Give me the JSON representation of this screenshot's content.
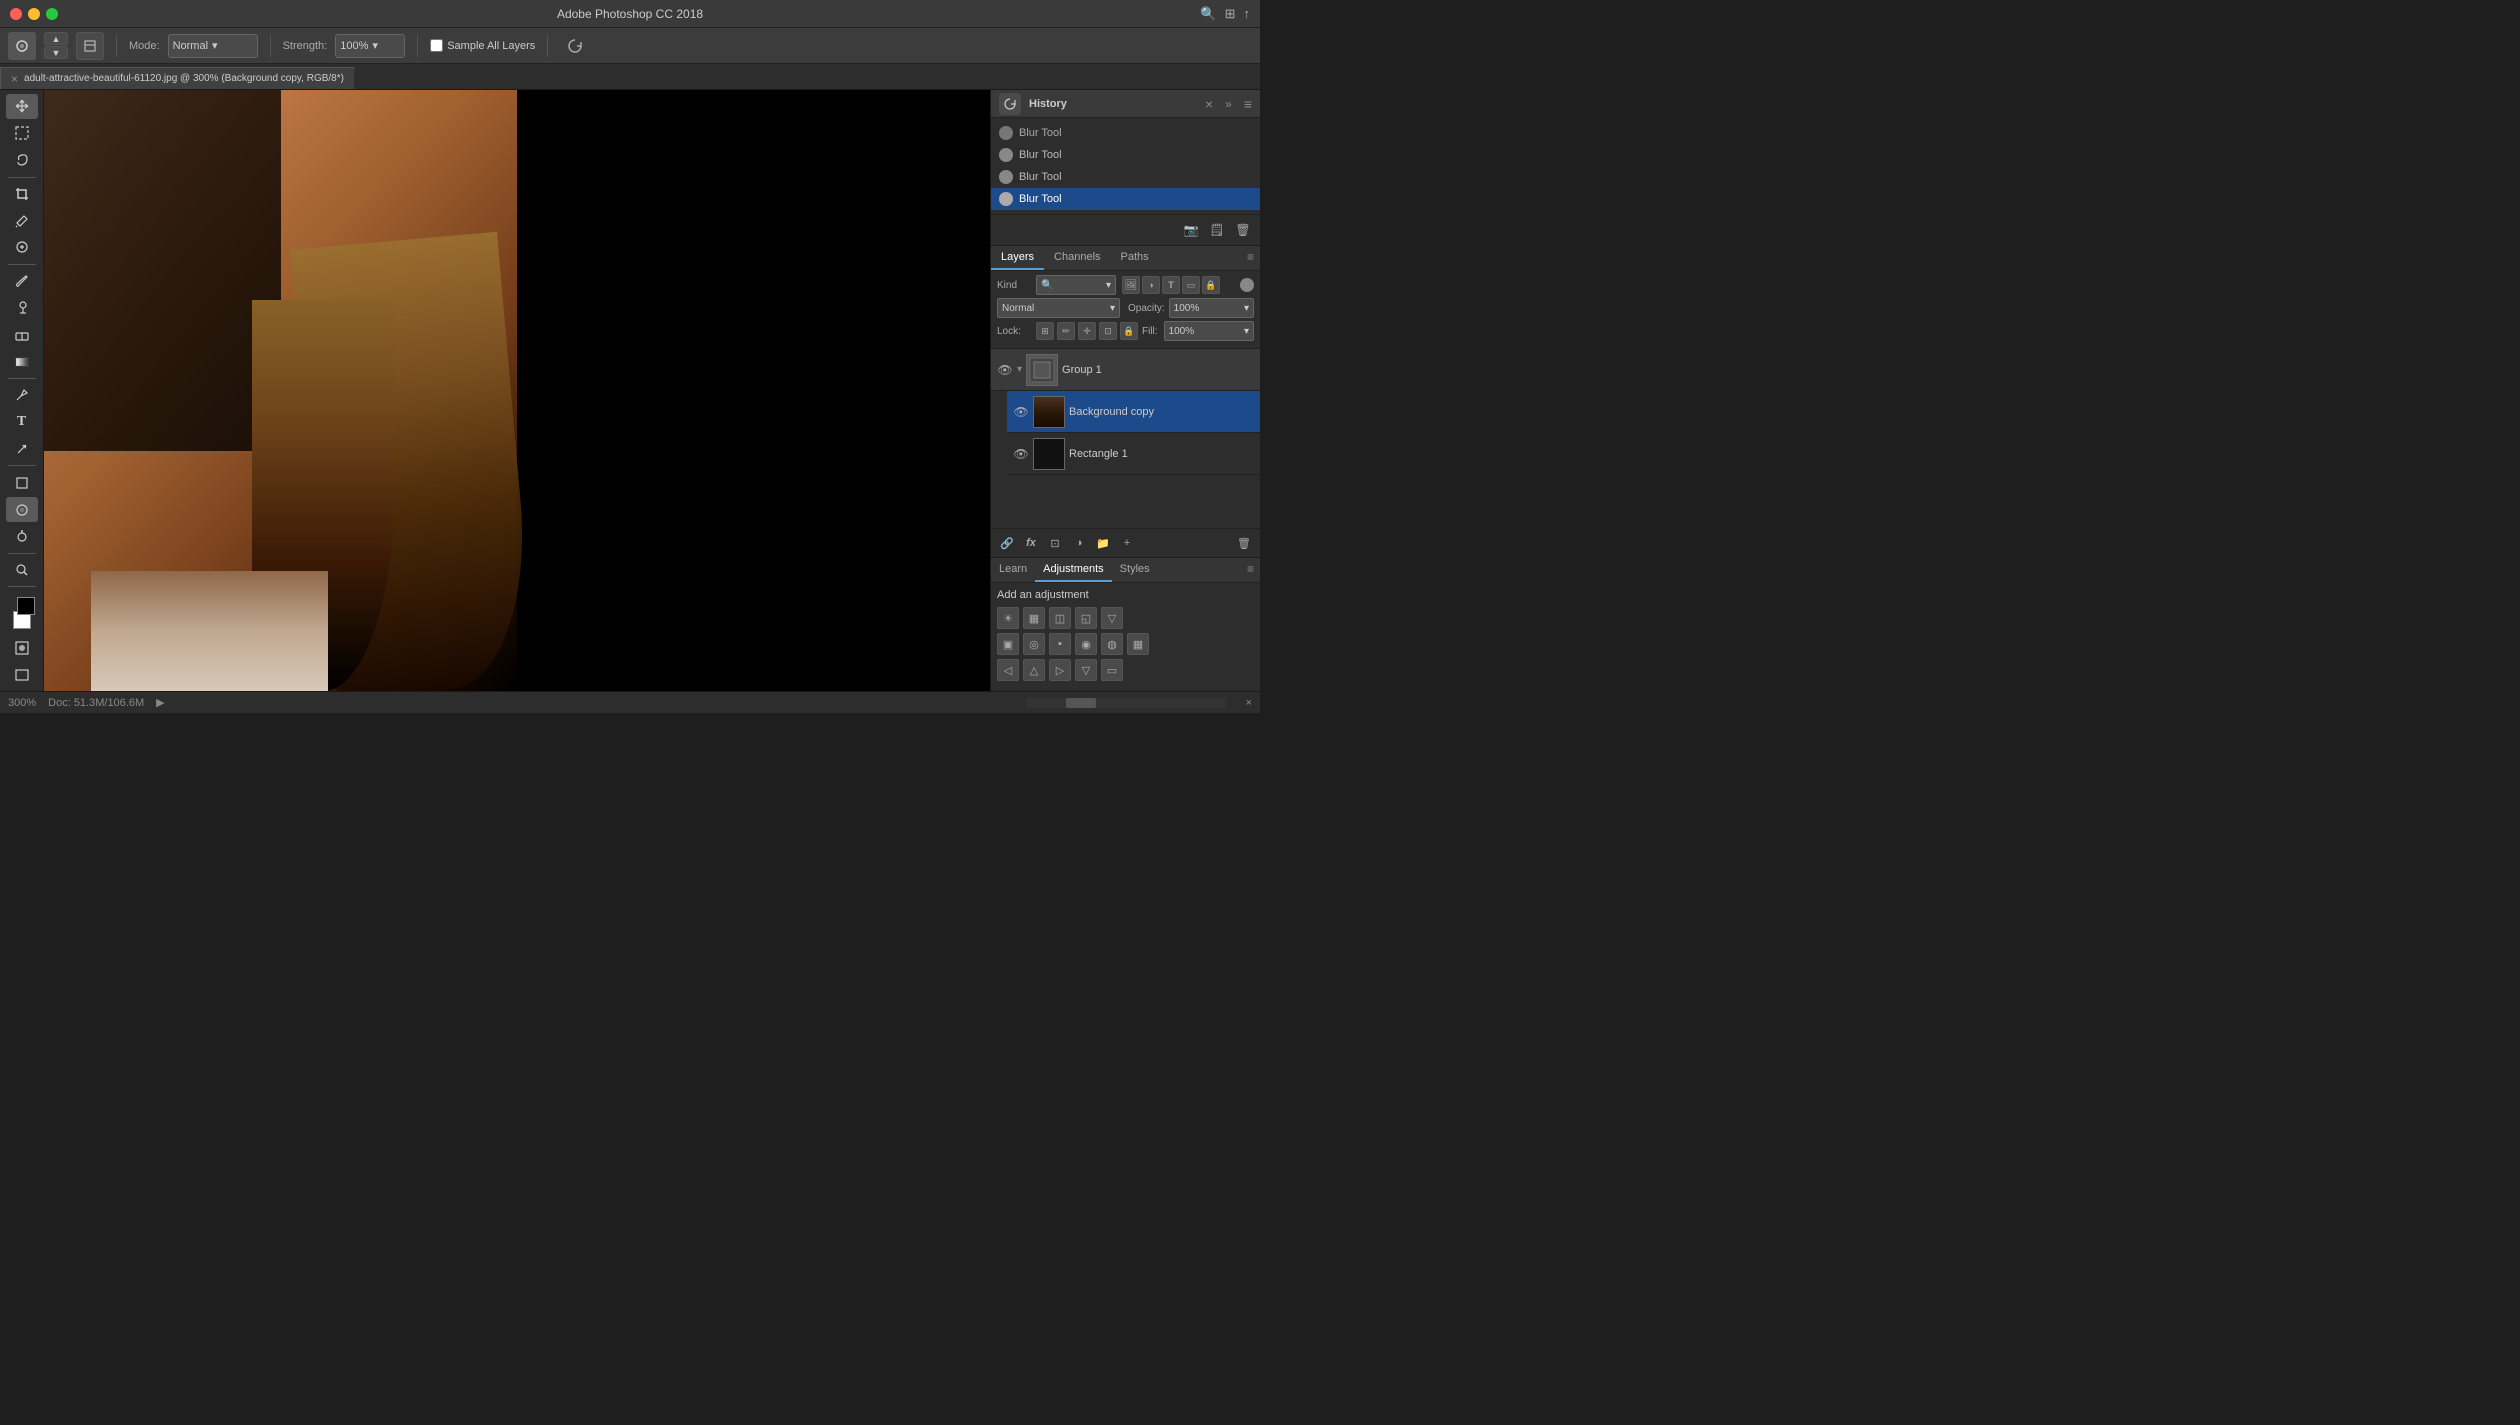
{
  "window": {
    "title": "Adobe Photoshop CC 2018",
    "traffic_lights": [
      "close",
      "minimize",
      "maximize"
    ]
  },
  "toolbar": {
    "mode_label": "Mode:",
    "mode_value": "Normal",
    "strength_label": "Strength:",
    "strength_value": "100%",
    "sample_all_layers_label": "Sample All Layers"
  },
  "doc_tab": {
    "name": "adult-attractive-beautiful-61120.jpg @ 300% (Background copy, RGB/8*)",
    "close": "×"
  },
  "history_panel": {
    "title": "History",
    "items": [
      {
        "label": "Blur Tool",
        "active": false
      },
      {
        "label": "Blur Tool",
        "active": false
      },
      {
        "label": "Blur Tool",
        "active": false
      },
      {
        "label": "Blur Tool",
        "active": true
      }
    ]
  },
  "layers_panel": {
    "tabs": [
      "Layers",
      "Channels",
      "Paths"
    ],
    "active_tab": "Layers",
    "blend_mode": "Normal",
    "opacity_label": "Opacity:",
    "opacity_value": "100%",
    "fill_label": "Fill:",
    "fill_value": "100%",
    "lock_label": "Lock:",
    "layers": [
      {
        "name": "Group 1",
        "type": "group",
        "visible": true,
        "expanded": true
      },
      {
        "name": "Background copy",
        "type": "layer",
        "visible": true,
        "active": true,
        "indent": true
      },
      {
        "name": "Rectangle 1",
        "type": "layer",
        "visible": true,
        "indent": true
      }
    ]
  },
  "adjustments_panel": {
    "tabs": [
      "Learn",
      "Adjustments",
      "Styles"
    ],
    "active_tab": "Adjustments",
    "add_adjustment_label": "Add an adjustment",
    "icons_row1": [
      "☀",
      "▦",
      "◫",
      "◱",
      "▽"
    ],
    "icons_row2": [
      "▣",
      "◎",
      "▪",
      "◉",
      "◍",
      "▦"
    ],
    "icons_row3": [
      "◁",
      "△",
      "▷",
      "▽",
      "▭"
    ]
  },
  "status_bar": {
    "zoom": "300%",
    "doc_info": "Doc: 51.3M/106.6M"
  }
}
